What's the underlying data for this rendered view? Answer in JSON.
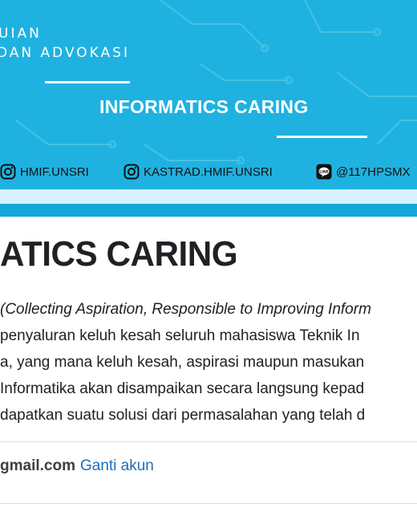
{
  "banner": {
    "org_line1": "UIAN",
    "org_line2": "DAN ADVOKASI",
    "title": "INFORMATICS CARING",
    "colors": {
      "background": "#1fb2e0",
      "band_light": "#d8f1fb",
      "band_dark": "#12a6da"
    },
    "socials": [
      {
        "icon": "instagram-icon",
        "handle": "HMIF.UNSRI"
      },
      {
        "icon": "instagram-icon",
        "handle": "KASTRAD.HMIF.UNSRI"
      },
      {
        "icon": "line-icon",
        "handle": "@117HPSMX"
      }
    ]
  },
  "form": {
    "title": "ATICS CARING",
    "description_lines": [
      "(Collecting Aspiration, Responsible to Improving Inform",
      " penyaluran keluh kesah seluruh mahasiswa Teknik In",
      "a, yang mana keluh kesah, aspirasi maupun masukan",
      " Informatika akan disampaikan secara langsung kepad",
      "dapatkan suatu solusi dari permasalahan yang telah d"
    ],
    "account_email": "gmail.com",
    "switch_account": "Ganti akun"
  }
}
